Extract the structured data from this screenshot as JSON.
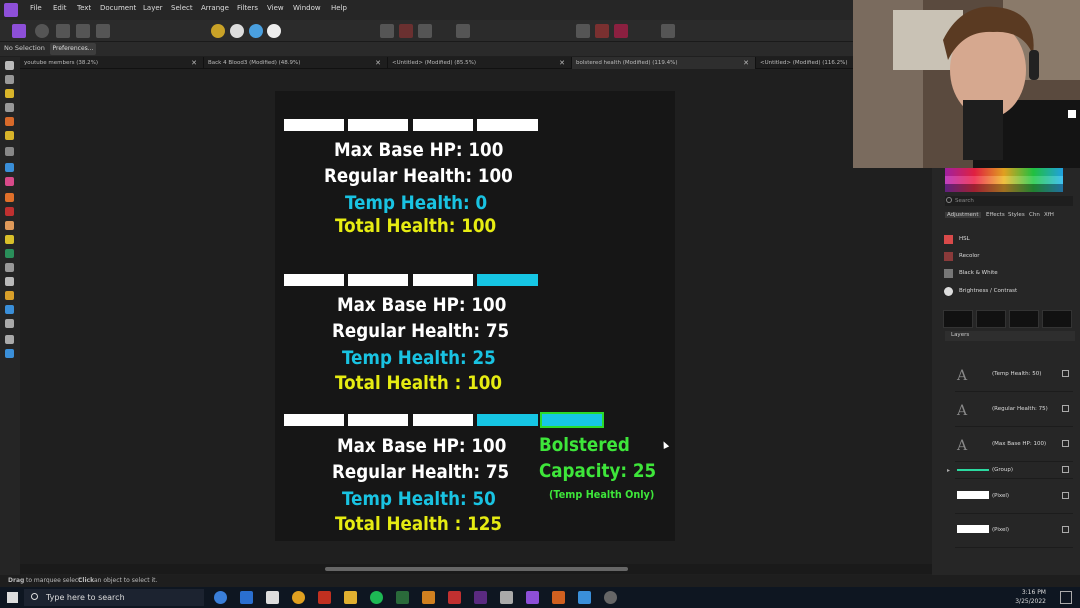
{
  "menubar": {
    "items": [
      "File",
      "Edit",
      "Text",
      "Document",
      "Layer",
      "Select",
      "Arrange",
      "Filters",
      "View",
      "Window",
      "Help"
    ]
  },
  "context": {
    "selection": "No Selection",
    "preferences": "Preferences..."
  },
  "tabs": [
    {
      "label": "youtube members (38.2%)"
    },
    {
      "label": "Back 4 Blood3 (Modified) (48.9%)"
    },
    {
      "label": "<Untitled> (Modified) (85.5%)"
    },
    {
      "label": "bolstered health (Modified) (119.4%)"
    },
    {
      "label": "<Untitled> (Modified) (116.2%)"
    }
  ],
  "artboard": {
    "block1": {
      "max_base": "Max Base HP: 100",
      "regular": "Regular Health: 100",
      "temp": "Temp Health: 0",
      "total": "Total Health: 100"
    },
    "block2": {
      "max_base": "Max Base HP: 100",
      "regular": "Regular Health: 75",
      "temp": "Temp Health: 25",
      "total": "Total Health : 100"
    },
    "block3": {
      "max_base": "Max Base HP: 100",
      "regular": "Regular Health: 75",
      "temp": "Temp Health: 50",
      "total": "Total Health : 125",
      "bolstered_1": "Bolstered",
      "bolstered_2": "Capacity: 25",
      "bolstered_note": "(Temp Health Only)"
    },
    "colors": {
      "white": "#ffffff",
      "cyan": "#19c3e2",
      "yellow": "#e6ec12",
      "green": "#3ee63a"
    }
  },
  "right_panel": {
    "search_placeholder": "Search",
    "tabs": [
      "Adjustment",
      "Effects",
      "Styles",
      "Chn",
      "XfH"
    ],
    "adjustments": [
      "HSL",
      "Recolor",
      "Black & White",
      "Brightness / Contrast"
    ],
    "layers_tab": "Layers",
    "layers": [
      "(Temp Health: 50)",
      "(Regular Health: 75)",
      "(Max Base HP: 100)",
      "(Group)",
      "(Pixel)",
      "(Pixel)"
    ]
  },
  "status": {
    "hint_prefix": "Drag",
    "hint_mid": " to marquee select. ",
    "hint_click": "Click",
    "hint_suffix": " an object to select it."
  },
  "taskbar": {
    "search_placeholder": "Type here to search",
    "time": "3:16 PM",
    "date": "3/25/2022"
  }
}
